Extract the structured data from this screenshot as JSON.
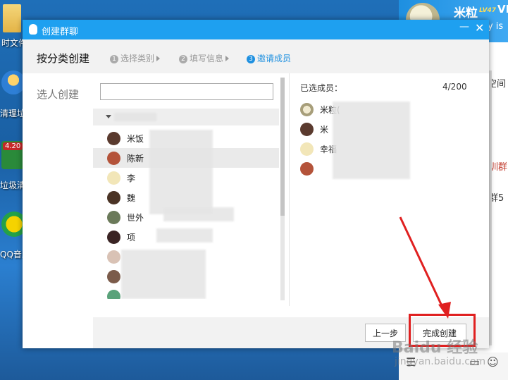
{
  "desktop": {
    "icons": [
      {
        "label": "时文件"
      },
      {
        "label": "清理垃圾"
      },
      {
        "label": "垃圾清理",
        "badge": "4.20"
      },
      {
        "label": "QQ音乐"
      }
    ]
  },
  "qq_main": {
    "name": "米粒",
    "level": "LV47",
    "vip": "VII",
    "signature": "ay is",
    "side_texts": [
      "空间",
      "训群",
      "群5"
    ]
  },
  "dialog": {
    "title": "创建群聊",
    "minimize_icon": "—",
    "close_icon": "✕",
    "mode_label": "按分类创建",
    "steps": [
      {
        "num": "1",
        "label": "选择类别",
        "active": false
      },
      {
        "num": "2",
        "label": "填写信息",
        "active": false
      },
      {
        "num": "3",
        "label": "邀请成员",
        "active": true
      }
    ],
    "pick_label": "选人创建",
    "search_placeholder": "",
    "friends": [
      "米饭",
      "陈新",
      "李",
      "魏",
      "世外",
      "项",
      "",
      "",
      ""
    ],
    "selected_title": "已选成员：",
    "selected_count": "4/200",
    "selected": [
      "米粒(",
      "米",
      "幸福",
      ""
    ],
    "prev_button": "上一步",
    "done_button": "完成创建"
  },
  "watermark": {
    "line1": "Baidu 经验",
    "line2": "jingyan.baidu.com"
  },
  "colors": {
    "title_bar": "#1ea0f0",
    "active_step": "#1e90e0",
    "highlight": "#e02020"
  }
}
